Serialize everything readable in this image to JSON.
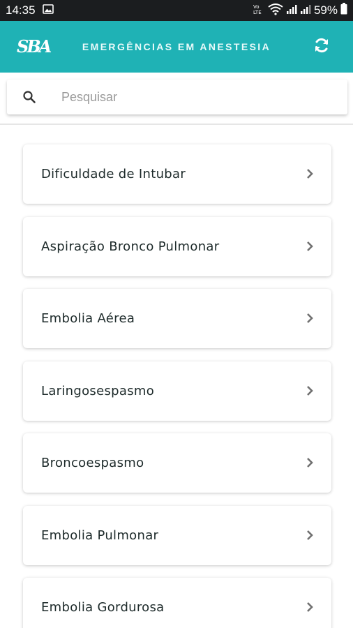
{
  "status_bar": {
    "time": "14:35",
    "battery": "59%",
    "icons": [
      "image-notification-icon",
      "volte-icon",
      "wifi-icon",
      "signal-icon",
      "signal-icon",
      "battery-icon"
    ]
  },
  "app_bar": {
    "logo_text": "SBA",
    "title": "EMERGÊNCIAS EM ANESTESIA",
    "refresh_icon": "refresh-icon",
    "background_color": "#1fb2b5"
  },
  "search": {
    "placeholder": "Pesquisar",
    "value": "",
    "icon": "search-icon"
  },
  "list": {
    "items": [
      {
        "label": "Dificuldade de Intubar"
      },
      {
        "label": "Aspiração Bronco Pulmonar"
      },
      {
        "label": "Embolia Aérea"
      },
      {
        "label": "Laringosespasmo"
      },
      {
        "label": "Broncoespasmo"
      },
      {
        "label": "Embolia Pulmonar"
      },
      {
        "label": "Embolia Gordurosa"
      }
    ],
    "chevron_icon": "chevron-right-icon"
  }
}
